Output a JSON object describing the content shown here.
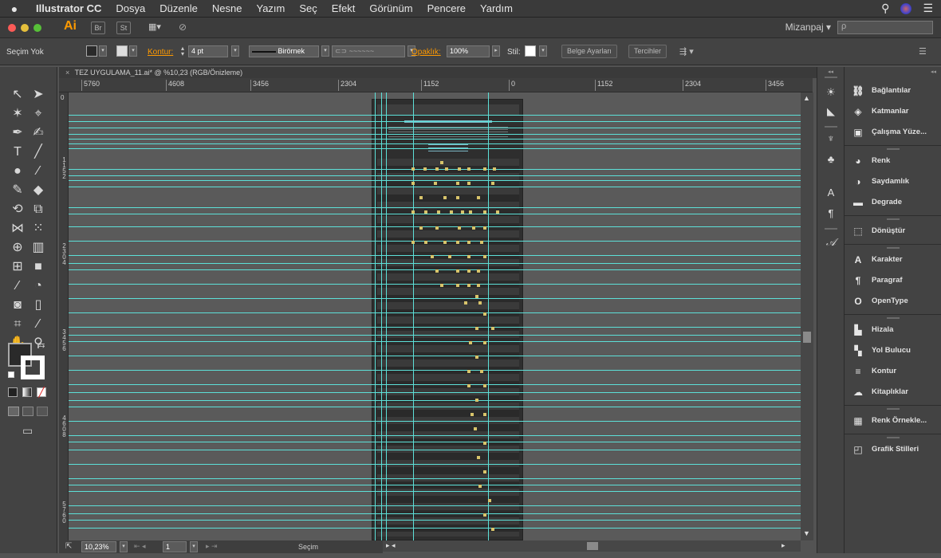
{
  "menubar": {
    "app": "Illustrator CC",
    "items": [
      "Dosya",
      "Düzenle",
      "Nesne",
      "Yazım",
      "Seç",
      "Efekt",
      "Görünüm",
      "Pencere",
      "Yardım"
    ]
  },
  "appbar": {
    "logo": "Ai",
    "bridge": "Br",
    "stock": "St",
    "workspace": "Mizanpaj",
    "search_placeholder": "ρ"
  },
  "control": {
    "selection": "Seçim Yok",
    "stroke_label": "Kontur:",
    "stroke_value": "4 pt",
    "brush_label": "Birörnek",
    "opacity_label": "Opaklık:",
    "opacity_value": "100%",
    "style_label": "Stil:",
    "doc_setup": "Belge Ayarları",
    "preferences": "Tercihler"
  },
  "document": {
    "tab": "TEZ UYGULAMA_11.ai* @ %10,23 (RGB/Önizleme)"
  },
  "ruler": {
    "h_ticks": [
      "5760",
      "4608",
      "3456",
      "2304",
      "1152",
      "0",
      "1152",
      "2304",
      "3456"
    ],
    "v_ticks": [
      "0",
      "1152",
      "2304",
      "3456",
      "4608",
      "5760"
    ]
  },
  "status": {
    "zoom": "10,23%",
    "artboard": "1",
    "tool": "Seçim"
  },
  "panels": {
    "items": [
      {
        "label": "Bağlantılar",
        "icon": "links-icon"
      },
      {
        "label": "Katmanlar",
        "icon": "layers-icon"
      },
      {
        "label": "Çalışma Yüze...",
        "icon": "artboards-icon"
      },
      {
        "label": "Renk",
        "icon": "color-icon"
      },
      {
        "label": "Saydamlık",
        "icon": "transparency-icon"
      },
      {
        "label": "Degrade",
        "icon": "gradient-icon"
      },
      {
        "label": "Dönüştür",
        "icon": "transform-icon"
      },
      {
        "label": "Karakter",
        "icon": "character-icon"
      },
      {
        "label": "Paragraf",
        "icon": "paragraph-icon"
      },
      {
        "label": "OpenType",
        "icon": "opentype-icon"
      },
      {
        "label": "Hizala",
        "icon": "align-icon"
      },
      {
        "label": "Yol Bulucu",
        "icon": "pathfinder-icon"
      },
      {
        "label": "Kontur",
        "icon": "stroke-icon"
      },
      {
        "label": "Kitaplıklar",
        "icon": "libraries-icon"
      },
      {
        "label": "Renk Örnekle...",
        "icon": "swatches-icon"
      },
      {
        "label": "Grafik Stilleri",
        "icon": "graphic-styles-icon"
      }
    ]
  },
  "colors": {
    "guide": "#5de0d8",
    "accent": "#ff9a00"
  }
}
